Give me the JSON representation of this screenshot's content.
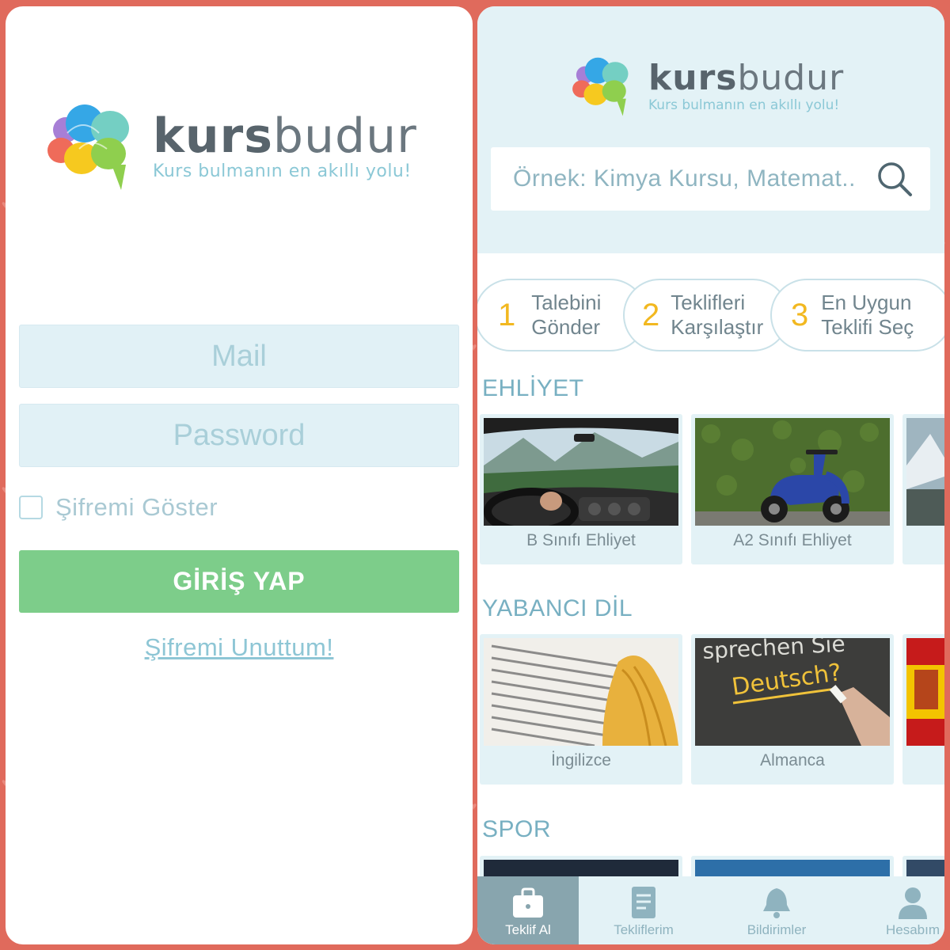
{
  "colors": {
    "background": "#e06a5c",
    "accent_green": "#7dcd8a",
    "panel_light_blue": "#e3f2f6",
    "step_number_yellow": "#f2b820",
    "nav_active": "#88a5ae"
  },
  "left_screen": {
    "logo": {
      "bold": "kurs",
      "light": "budur",
      "slogan": "Kurs bulmanın en akıllı yolu!"
    },
    "mail_placeholder": "Mail",
    "password_placeholder": "Password",
    "show_password_label": "Şifremi Göster",
    "show_password_checked": false,
    "login_button": "GİRİŞ YAP",
    "forgot_link": "Şifremi Unuttum!"
  },
  "right_screen": {
    "logo": {
      "bold": "kurs",
      "light": "budur",
      "slogan": "Kurs bulmanın en akıllı yolu!"
    },
    "search_placeholder": "Örnek: Kimya Kursu, Matemat..",
    "steps": [
      {
        "number": "1",
        "line1": "Talebini",
        "line2": "Gönder"
      },
      {
        "number": "2",
        "line1": "Teklifleri",
        "line2": "Karşılaştır"
      },
      {
        "number": "3",
        "line1": "En Uygun",
        "line2": "Teklifi Seç"
      }
    ],
    "sections": [
      {
        "title": "EHLİYET",
        "cards": [
          "B Sınıfı Ehliyet",
          "A2 Sınıfı Ehliyet"
        ]
      },
      {
        "title": "YABANCI DİL",
        "cards": [
          "İngilizce",
          "Almanca"
        ]
      },
      {
        "title": "SPOR",
        "cards": []
      }
    ],
    "card_image_texts": {
      "deutsch_board_top": "sprechen Sie",
      "deutsch_board": "Deutsch?"
    },
    "bottom_nav": [
      {
        "label": "Teklif Al",
        "icon": "briefcase-icon",
        "active": true
      },
      {
        "label": "Tekliflerim",
        "icon": "document-icon",
        "active": false
      },
      {
        "label": "Bildirimler",
        "icon": "bell-icon",
        "active": false
      },
      {
        "label": "Hesabım",
        "icon": "user-icon",
        "active": false
      }
    ]
  }
}
